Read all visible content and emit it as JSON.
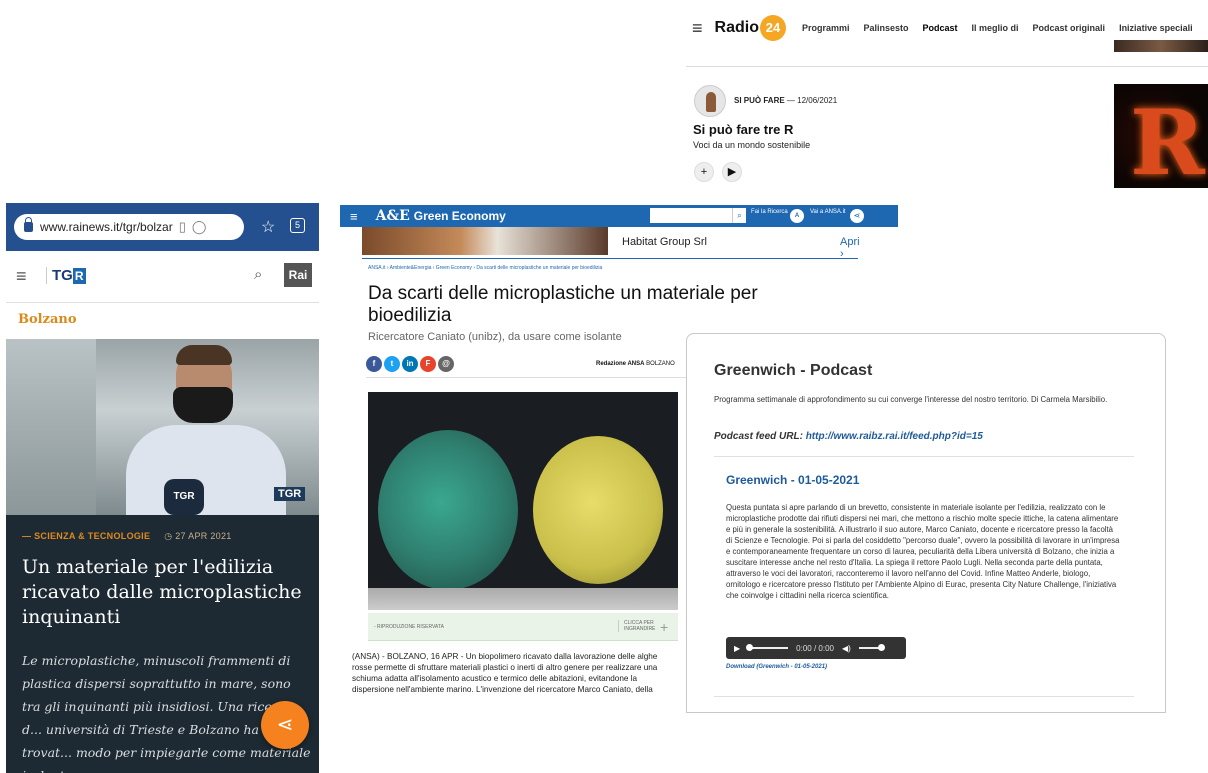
{
  "radio24": {
    "logo_text": "Radio",
    "logo_num": "24",
    "nav": [
      "Programmi",
      "Palinsesto",
      "Podcast",
      "Il meglio di",
      "Podcast originali",
      "Iniziative speciali"
    ],
    "active_nav": "Podcast",
    "show": "SI PUÒ FARE",
    "date": "— 12/06/2021",
    "episode_title": "Si può fare tre R",
    "episode_sub": "Voci da un mondo sostenibile",
    "add_label": "+",
    "play_label": "▶",
    "cover_letter": "R"
  },
  "tgr": {
    "url": "www.rainews.it/tgr/bolzar",
    "logo": "TG",
    "logo_r": "R",
    "rai_label": "Rai",
    "region": "Bolzano",
    "photo_mic": "TGR",
    "photo_watermark": "TGR",
    "category": "— SCIENZA & TECNOLOGIE",
    "date": "◷ 27 APR 2021",
    "title": "Un materiale per l'edilizia ricavato dalle microplastiche inquinanti",
    "lead": "Le microplastiche, minuscoli frammenti di plastica dispersi soprattutto in mare, sono tra gli inquinanti più insidiosi. Una ricerca d... università di Trieste e Bolzano ha trovat... modo per impiegarle come materiale isolante"
  },
  "ansa": {
    "brand": "A&E",
    "section": "Green Economy",
    "search_label": "Fai la Ricerca",
    "visit_label": "Vai a ANSA.it",
    "ad_advertiser": "Habitat Group Srl",
    "ad_cta": "Apri  ›",
    "breadcrumb": "ANSA.it  ›  Ambiente&Energia  ›  Green Economy  ›  Da scarti delle microplastiche un materiale per bioedilizia",
    "headline": "Da scarti delle microplastiche un materiale per bioedilizia",
    "subhead": "Ricercatore Caniato (unibz), da usare come isolante",
    "redazione": "Redazione ANSA",
    "place": "BOLZANO",
    "caption_left": "- RIPRODUZIONE RISERVATA",
    "caption_right": "CLICCA PER INGRANDIRE",
    "body": "(ANSA) - BOLZANO, 16 APR - Un biopolimero ricavato dalla lavorazione delle alghe rosse permette di sfruttare materiali plastici o inerti di altro genere per realizzare una schiuma adatta all'isolamento acustico e termico delle abitazioni, evitandone la dispersione nell'ambiente marino. L'invenzione del ricercatore Marco Caniato, della"
  },
  "greenwich": {
    "title": "Greenwich - Podcast",
    "description": "Programma settimanale di approfondimento su cui converge l'interesse del nostro territorio. Di Carmela Marsibilio.",
    "feed_label": "Podcast feed URL: ",
    "feed_url": "http://www.raibz.rai.it/feed.php?id=15",
    "episode_title": "Greenwich - 01-05-2021",
    "episode_description": "Questa puntata si apre parlando di un brevetto, consistente in materiale isolante per l'edilizia, realizzato con le microplastiche prodotte dai rifiuti dispersi nei mari, che mettono a rischio molte specie ittiche, la catena alimentare e più in generale la sostenibilità. A illustrarlo il suo autore, Marco Caniato, docente e ricercatore presso la facoltà di Scienze e Tecnologie. Poi si parla del cosiddetto \"percorso duale\", ovvero la possibilità di lavorare in un'impresa e contemporaneamente frequentare un corso di laurea, peculiarità della Libera università di Bolzano, che inizia a suscitare interesse anche nel resto d'Italia. La spiega il rettore Paolo Lugli. Nella seconda parte della puntata, attraverso le voci dei lavoratori, racconteremo il lavoro nell'anno del Covid. Infine Matteo Anderle, biologo, ornitologo e ricercatore presso l'Istituto per l'Ambiente Alpino di Eurac, presenta City Nature Challenge, l'iniziativa che coinvolge i cittadini nella ricerca scientifica.",
    "player_time": "0:00 / 0:00",
    "download_label": "Download (Greenwich - 01-05-2021)"
  }
}
